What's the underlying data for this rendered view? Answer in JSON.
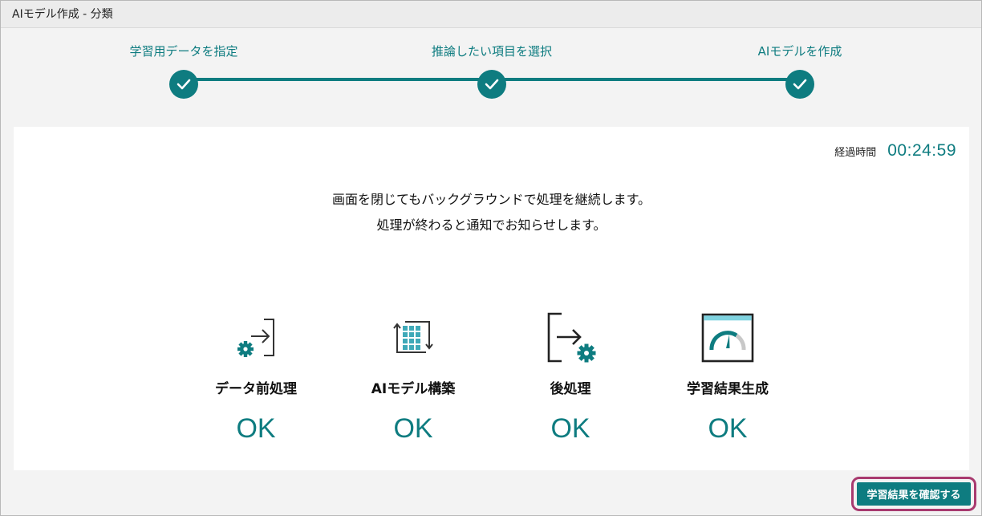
{
  "window": {
    "title": "AIモデル作成 - 分類"
  },
  "colors": {
    "accent": "#0e7c80",
    "highlight_border": "#a83a6f"
  },
  "steps": [
    {
      "label": "学習用データを指定",
      "icon": "check-icon",
      "state": "completed"
    },
    {
      "label": "推論したい項目を選択",
      "icon": "check-icon",
      "state": "completed"
    },
    {
      "label": "AIモデルを作成",
      "icon": "check-icon",
      "state": "completed"
    }
  ],
  "elapsed": {
    "label": "経過時間",
    "value": "00:24:59"
  },
  "message": {
    "line1": "画面を閉じてもバックグラウンドで処理を継続します。",
    "line2": "処理が終わると通知でお知らせします。"
  },
  "stages": [
    {
      "icon": "data-import-gear-icon",
      "label": "データ前処理",
      "status": "OK"
    },
    {
      "icon": "data-grid-build-icon",
      "label": "AIモデル構築",
      "status": "OK"
    },
    {
      "icon": "export-gear-icon",
      "label": "後処理",
      "status": "OK"
    },
    {
      "icon": "gauge-report-icon",
      "label": "学習結果生成",
      "status": "OK"
    }
  ],
  "footer": {
    "confirm_label": "学習結果を確認する"
  }
}
